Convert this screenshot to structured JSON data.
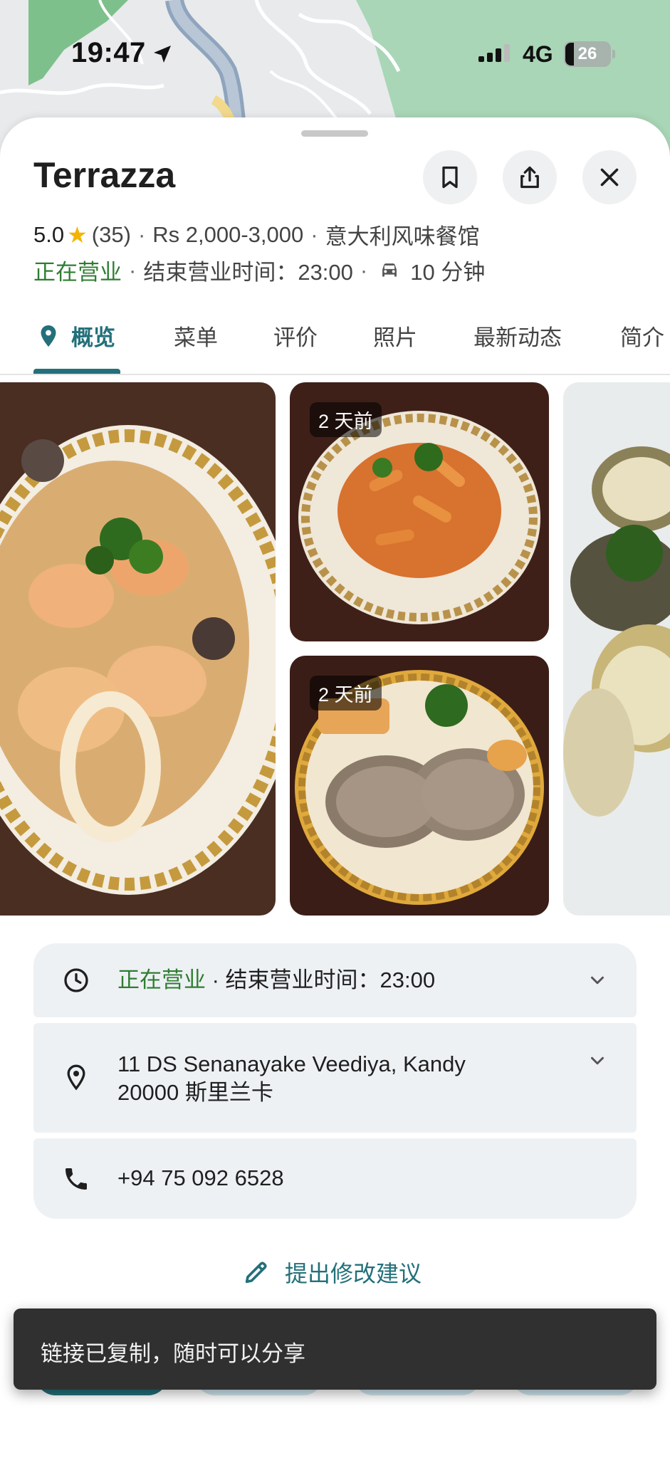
{
  "status_bar": {
    "time": "19:47",
    "network": "4G",
    "battery": "26",
    "icons": [
      "location-arrow-icon",
      "signal-icon",
      "battery-icon"
    ]
  },
  "place": {
    "name": "Terrazza",
    "rating": "5.0",
    "review_count": "(35)",
    "price": "Rs 2,000-3,000",
    "category": "意大利风味餐馆",
    "status": "正在营业",
    "closing": "结束营业时间：23:00",
    "drive_time": "10 分钟"
  },
  "actions": {
    "save_icon": "bookmark-icon",
    "share_icon": "share-icon",
    "close_icon": "close-icon"
  },
  "tabs": [
    {
      "label": "概览",
      "active": true
    },
    {
      "label": "菜单"
    },
    {
      "label": "评价"
    },
    {
      "label": "照片"
    },
    {
      "label": "最新动态"
    },
    {
      "label": "简介"
    }
  ],
  "photos": {
    "badge_1": "2 天前",
    "badge_2": "2 天前"
  },
  "details": {
    "hours_status": "正在营业",
    "hours_close": "· 结束营业时间：23:00",
    "address_line1": "11 DS Senanayake Veediya, Kandy",
    "address_line2": "20000 斯里兰卡",
    "phone": "+94 75 092 6528"
  },
  "suggest_edit": "提出修改建议",
  "toast": "链接已复制，随时可以分享",
  "colors": {
    "accent": "#23707a",
    "open_green": "#2f7d32",
    "star": "#f4b400",
    "card_bg": "#eef1f4",
    "toast_bg": "#303030"
  }
}
